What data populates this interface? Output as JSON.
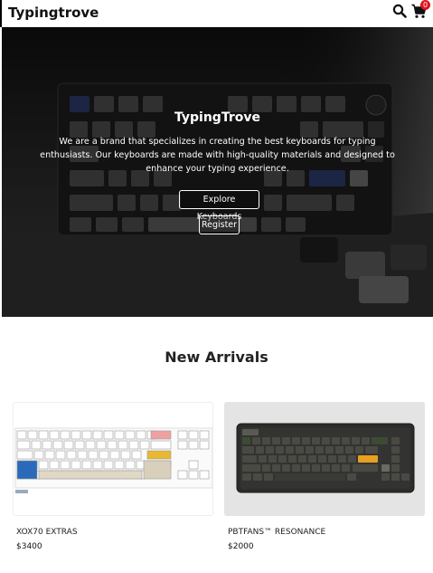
{
  "header": {
    "brand": "Typingtrove",
    "icons": [
      "search-icon",
      "cart-icon"
    ],
    "cart_count": "0"
  },
  "hero": {
    "title": "TypingTrove",
    "description": "We are a brand that specializes in creating the best keyboards for typing enthusiasts. Our keyboards are made with high-quality materials and designed to enhance your typing experience.",
    "explore_label": "Explore Keyboards",
    "register_label": "Register"
  },
  "new_arrivals": {
    "title": "New Arrivals",
    "products": [
      {
        "name": "XOX70 EXTRAS",
        "price": "$3400"
      },
      {
        "name": "PBTFANS™ RESONANCE",
        "price": "$2000"
      }
    ]
  },
  "colors": {
    "cart_badge": "#e0141c",
    "accent_orange": "#e8a020",
    "accent_blue": "#2a6ab8"
  }
}
